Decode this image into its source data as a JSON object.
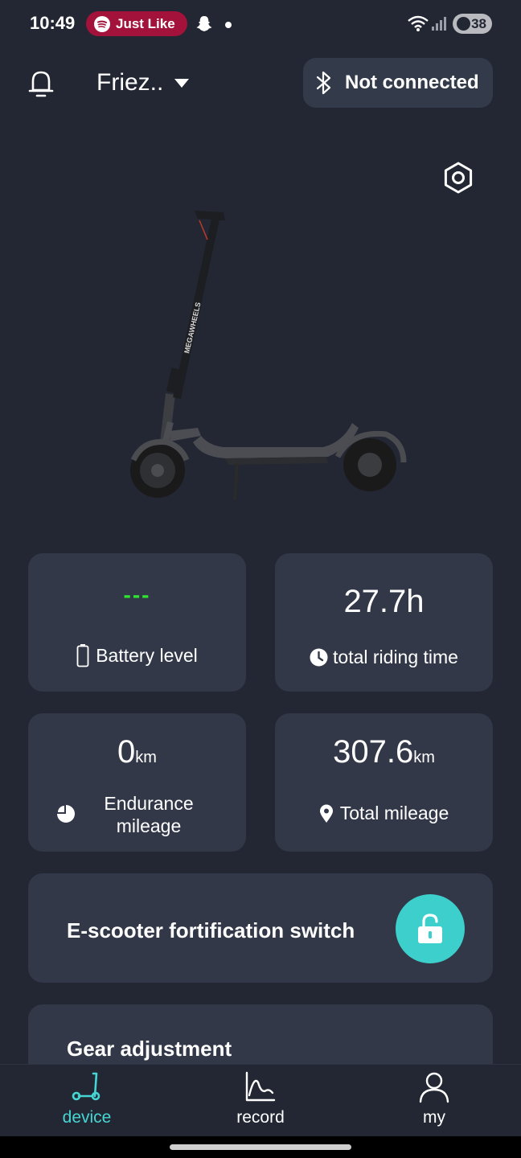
{
  "status_bar": {
    "time": "10:49",
    "spotify_text": "Just Like",
    "battery": "38"
  },
  "header": {
    "device_name": "Friez..",
    "bluetooth_status": "Not connected"
  },
  "stats": {
    "battery": {
      "value": "---",
      "label": "Battery level",
      "value_color": "#2ee52e"
    },
    "riding_time": {
      "value": "27.7h",
      "label": "total riding time"
    },
    "endurance": {
      "value": "0",
      "unit": "km",
      "label_line1": "Endurance",
      "label_line2": "mileage"
    },
    "total_mileage": {
      "value": "307.6",
      "unit": "km",
      "label": "Total mileage"
    }
  },
  "lock_card": {
    "title": "E-scooter fortification switch",
    "state": "unlocked"
  },
  "gear_card": {
    "title": "Gear adjustment"
  },
  "bottom_nav": {
    "items": [
      {
        "label": "device",
        "icon": "scooter-icon",
        "active": true
      },
      {
        "label": "record",
        "icon": "chart-icon",
        "active": false
      },
      {
        "label": "my",
        "icon": "person-icon",
        "active": false
      }
    ]
  },
  "colors": {
    "background": "#232733",
    "card": "#323848",
    "accent": "#45d6d3",
    "lock_button": "#3dcfcc",
    "spotify_pill": "#a3123a"
  },
  "icons": [
    "bell-icon",
    "bluetooth-icon",
    "settings-icon",
    "battery-icon",
    "clock-icon",
    "pie-icon",
    "location-pin-icon",
    "lock-open-icon"
  ]
}
